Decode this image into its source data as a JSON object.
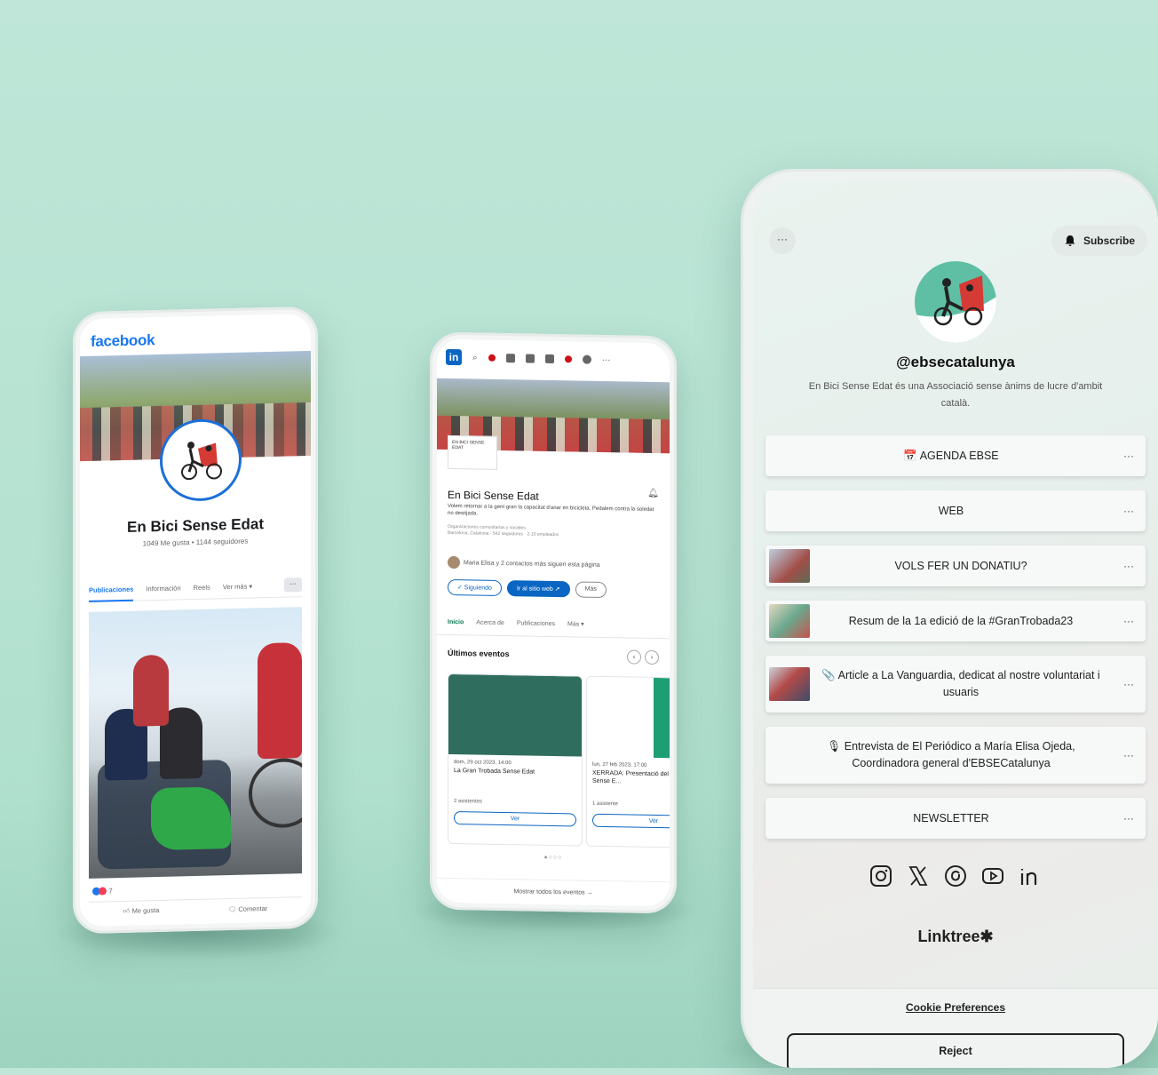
{
  "facebook": {
    "brand": "facebook",
    "page_name": "En Bici Sense Edat",
    "stats": "1049 Me gusta • 1144 seguidores",
    "tabs": [
      "Publicaciones",
      "Información",
      "Reels",
      "Ver más ▾"
    ],
    "more": "···",
    "reaction_count": "7",
    "like": "Me gusta",
    "comment": "Comentar"
  },
  "linkedin": {
    "logo": "in",
    "page_name": "En Bici Sense Edat",
    "logo_text": "EN BICI SENSE EDAT",
    "description": "Volem retornar a la gent gran la capacitat d'anar en bicicleta. Pedalem contra la soledat no desitjada.",
    "meta_line1": "Organizaciones comunitarias y sociales",
    "meta_line2": "Barcelona, Catalonia · 542 seguidores · 2-10 empleados",
    "followers_note": "Maria Elisa y 2 contactos más siguen esta página",
    "btn_following": "✓ Siguiendo",
    "btn_website": "Ir al sitio web ↗",
    "btn_more": "Más",
    "tabs": [
      "Inicio",
      "Acerca de",
      "Publicaciones",
      "Más ▾"
    ],
    "events_title": "Últimos eventos",
    "events": [
      {
        "date": "dom, 29 oct 2023, 14:00",
        "title": "La Gran Trobada Sense Edat",
        "attendees": "2 asistentes",
        "button": "Ver"
      },
      {
        "date": "lun, 27 feb 2023, 17:00",
        "title": "XERRADA: Presentació del projecte En Bici Sense E...",
        "attendees": "1 asistente",
        "button": "Ver"
      }
    ],
    "dots": "●○○○",
    "show_all": "Mostrar todos los eventos →",
    "more_dots": "···"
  },
  "linktree": {
    "menu": "···",
    "subscribe": "Subscribe",
    "handle": "@ebsecatalunya",
    "bio": "En Bici Sense Edat és una Associació sense ànims de lucre d'ambit català.",
    "links": [
      {
        "label": "📅 AGENDA EBSE",
        "thumb": false
      },
      {
        "label": "WEB",
        "thumb": false
      },
      {
        "label": "VOLS FER UN DONATIU?",
        "thumb": true
      },
      {
        "label": "Resum de la 1a edició de la #GranTrobada23",
        "thumb": true
      },
      {
        "label": "📎 Article a La Vanguardia, dedicat al nostre voluntariat i usuaris",
        "thumb": true
      },
      {
        "label": "🎙 Entrevista de El Periódico a María Elisa Ojeda, Coordinadora general d'EBSECatalunya",
        "thumb": false
      },
      {
        "label": "NEWSLETTER",
        "thumb": false
      }
    ],
    "link_more": "···",
    "socials": [
      "instagram-icon",
      "x-icon",
      "threads-icon",
      "youtube-icon",
      "linkedin-icon"
    ],
    "brand": "Linktree✱",
    "cookie_prefs": "Cookie Preferences",
    "reject": "Reject"
  }
}
